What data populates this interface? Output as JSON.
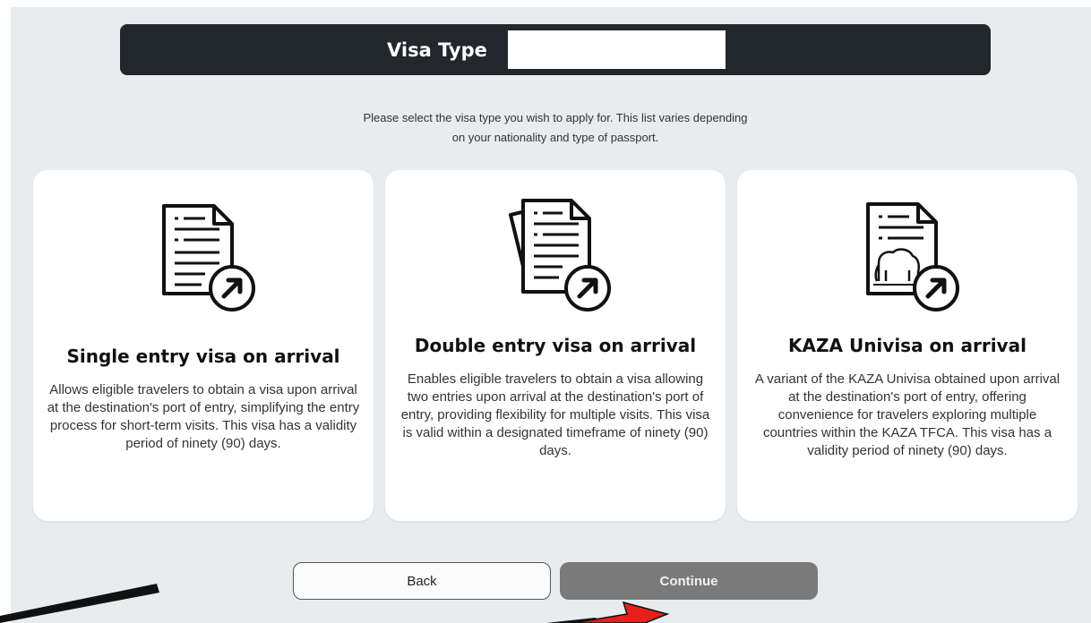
{
  "header": {
    "title": "Visa Type"
  },
  "intro": {
    "line1": "Please select the visa type you wish to apply for. This list varies depending",
    "line2": "on your nationality and type of passport."
  },
  "cards": [
    {
      "title": "Single entry visa on arrival",
      "description": "Allows eligible travelers to obtain a visa upon arrival at the destination's port of entry, simplifying the entry process for short-term visits. This visa has a validity period of ninety (90) days.",
      "icon": "single-document-arrow-icon"
    },
    {
      "title": "Double entry visa on arrival",
      "description": "Enables eligible travelers to obtain a visa allowing two entries upon arrival at the destination's port of entry, providing flexibility for multiple visits. This visa is valid within a designated timeframe of ninety (90) days.",
      "icon": "stacked-documents-arrow-icon"
    },
    {
      "title": "KAZA Univisa on arrival",
      "description": "A variant of the KAZA Univisa obtained upon arrival at the destination's port of entry, offering convenience for travelers exploring multiple countries within the KAZA TFCA. This visa has a validity period of ninety (90) days.",
      "icon": "elephant-document-arrow-icon"
    }
  ],
  "buttons": {
    "back": "Back",
    "continue": "Continue"
  },
  "colors": {
    "header_bg": "#22272b",
    "panel_bg": "#e8ecee",
    "continue_bg": "#7a7a7a",
    "annotation_arrow": "#e8201c"
  }
}
